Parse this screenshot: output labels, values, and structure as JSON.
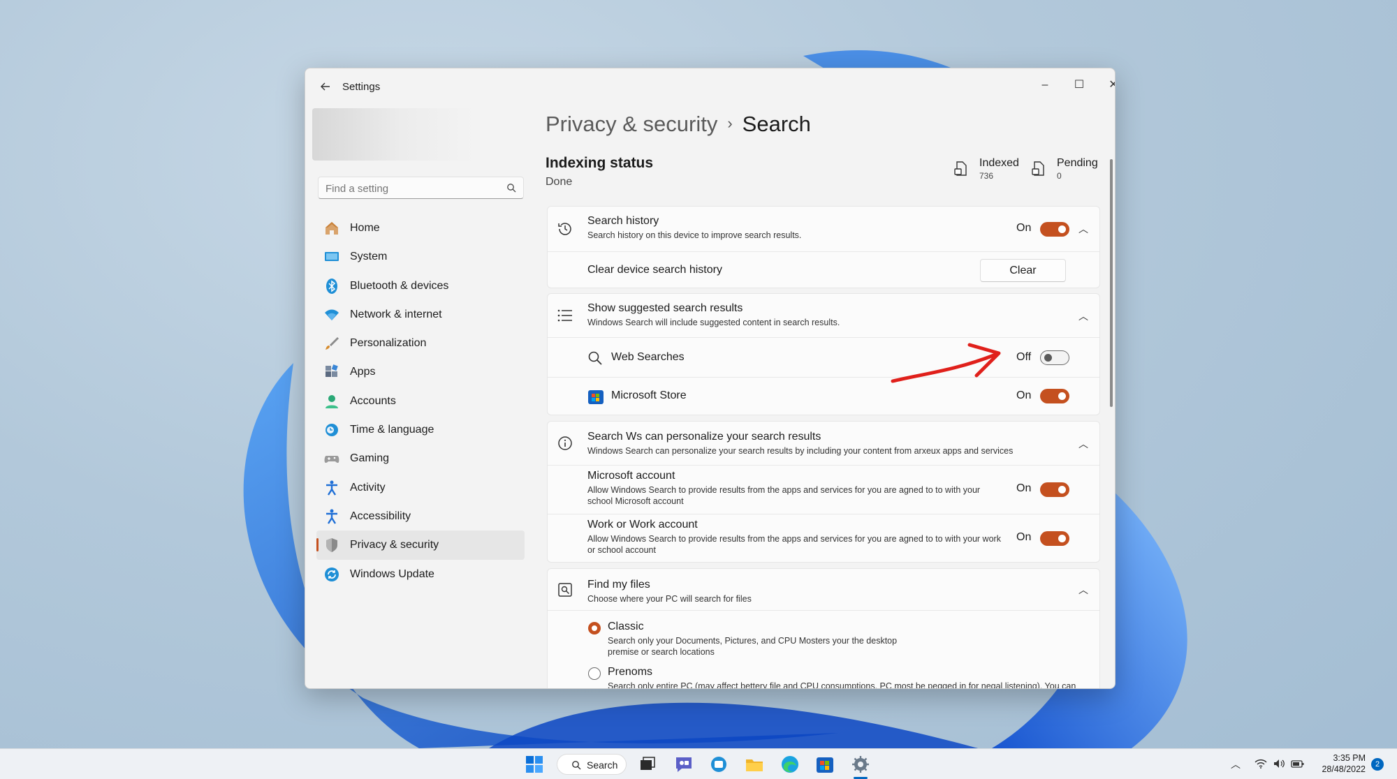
{
  "window": {
    "app_title": "Settings",
    "controls": {
      "minimize": "–",
      "maximize": "☐",
      "close": "✕"
    }
  },
  "sidebar": {
    "search_placeholder": "Find a setting",
    "items": [
      {
        "label": "Home",
        "icon": "home-icon",
        "color": "#c9823a"
      },
      {
        "label": "System",
        "icon": "system-icon",
        "color": "#1f8fd6"
      },
      {
        "label": "Bluetooth & devices",
        "icon": "bluetooth-icon",
        "color": "#1f8fd6"
      },
      {
        "label": "Network & internet",
        "icon": "wifi-icon",
        "color": "#1f8fd6"
      },
      {
        "label": "Personalization",
        "icon": "brush-icon",
        "color": "#d68a2a"
      },
      {
        "label": "Apps",
        "icon": "apps-icon",
        "color": "#5b6a80"
      },
      {
        "label": "Accounts",
        "icon": "person-icon",
        "color": "#2aa876"
      },
      {
        "label": "Time & language",
        "icon": "clock-globe-icon",
        "color": "#1f8fd6"
      },
      {
        "label": "Gaming",
        "icon": "controller-icon",
        "color": "#8a8a8a"
      },
      {
        "label": "Activity",
        "icon": "activity-icon",
        "color": "#1f6fd6"
      },
      {
        "label": "Accessibility",
        "icon": "accessibility-icon",
        "color": "#1f6fd6"
      },
      {
        "label": "Privacy & security",
        "icon": "shield-icon",
        "color": "#7a7a7a",
        "selected": true
      },
      {
        "label": "Windows Update",
        "icon": "update-icon",
        "color": "#1f8fd6"
      }
    ]
  },
  "header": {
    "parent": "Privacy & security",
    "separator": "›",
    "current": "Search"
  },
  "indexing": {
    "title": "Indexing status",
    "status": "Done",
    "indexed_label": "Indexed",
    "indexed_value": "736",
    "pending_label": "Pending",
    "pending_value": "0"
  },
  "search_history": {
    "title": "Search history",
    "desc": "Search history on this device to improve search results.",
    "state": "On",
    "toggle_on": true,
    "clear_label": "Clear device search history",
    "clear_button": "Clear"
  },
  "suggested": {
    "title": "Show suggested search results",
    "desc": "Windows Search will include suggested content in search results.",
    "items": [
      {
        "label": "Web Searches",
        "state": "Off",
        "toggle_on": false
      },
      {
        "label": "Microsoft Store",
        "state": "On",
        "toggle_on": true
      }
    ]
  },
  "personalize": {
    "title": "Search Ws can personalize your search results",
    "desc": "Windows Search can personalize your search results by including your content from arxeux apps and services",
    "items": [
      {
        "title": "Microsoft account",
        "desc": "Allow Windows Search to provide results from the apps and services for you are agned to to with your school Microsoft account",
        "state": "On",
        "toggle_on": true
      },
      {
        "title": "Work or Work account",
        "desc": "Allow Windows Search to provide results from the apps and services for you are agned to to with your work or school account",
        "state": "On",
        "toggle_on": true
      }
    ]
  },
  "find_files": {
    "title": "Find my files",
    "desc": "Choose where your PC will search for files",
    "options": [
      {
        "label": "Classic",
        "desc": "Search only your Documents, Pictures, and CPU Mosters your the desktop premise or search locations",
        "checked": true
      },
      {
        "label": "Prenoms",
        "desc": "Search only entire PC (may affect bettery file and CPU consumptions. PC most be pegged in for negal listening). You can manage",
        "checked": false
      }
    ]
  },
  "taskbar": {
    "search_label": "Search",
    "time": "3:35 PM",
    "date": "28/48/2022",
    "notification_count": "2"
  },
  "colors": {
    "accent": "#c4501f",
    "annotation": "#e0201b"
  }
}
